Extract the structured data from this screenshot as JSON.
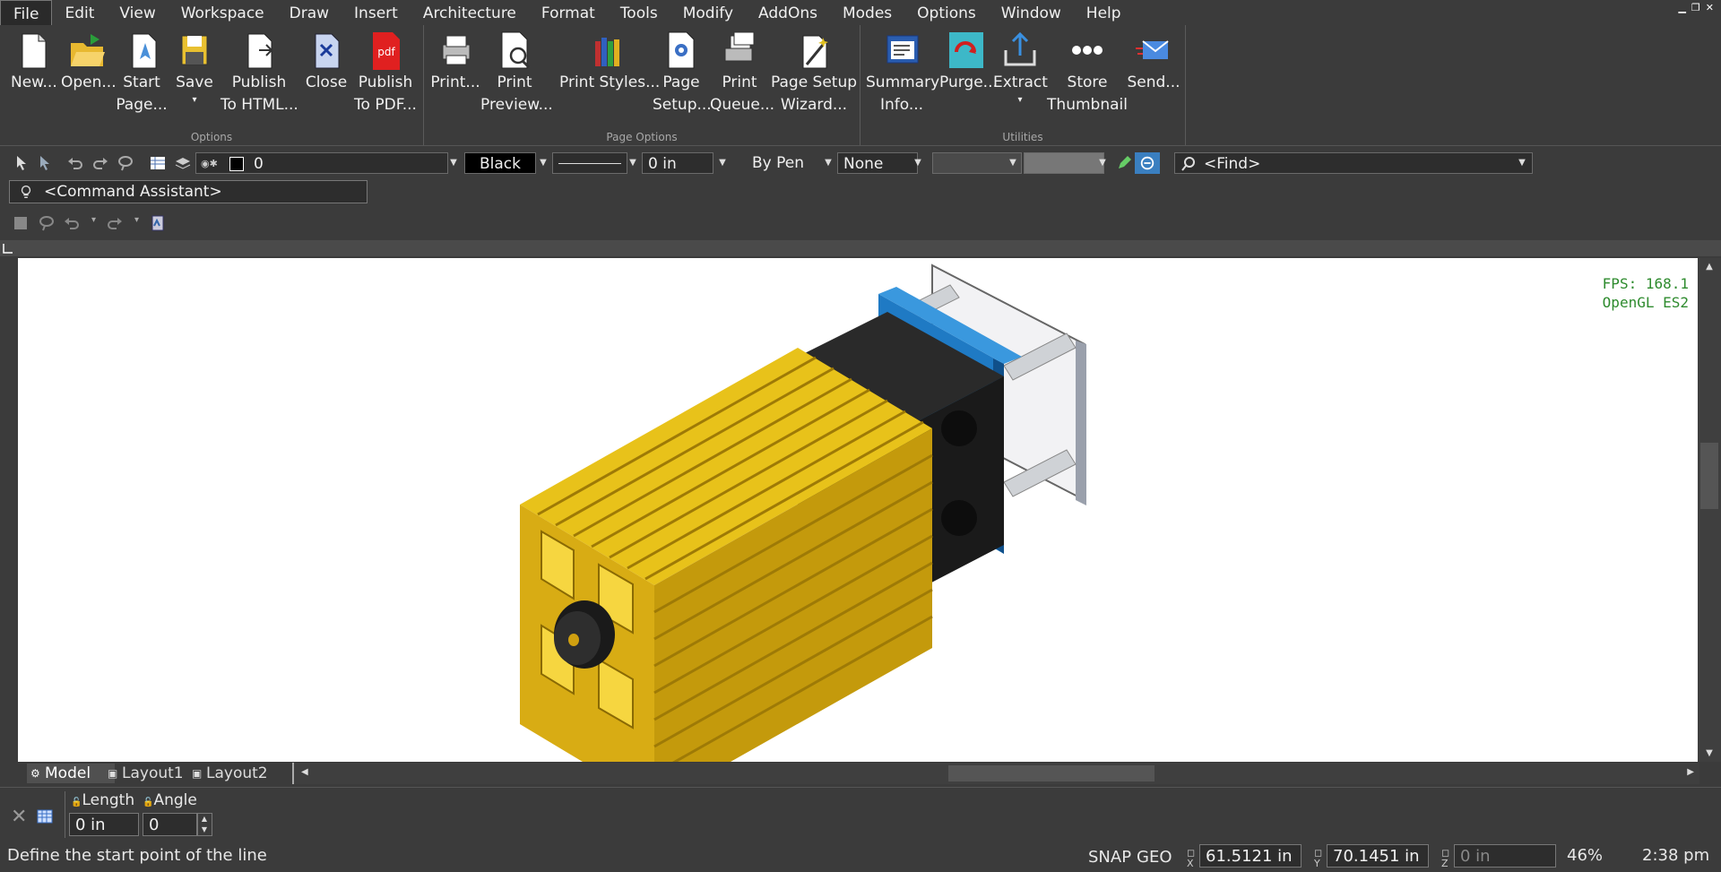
{
  "menu": [
    "File",
    "Edit",
    "View",
    "Workspace",
    "Draw",
    "Insert",
    "Architecture",
    "Format",
    "Tools",
    "Modify",
    "AddOns",
    "Modes",
    "Options",
    "Window",
    "Help"
  ],
  "ribbon": {
    "groups": {
      "options": "Options",
      "page_options": "Page Options",
      "utilities": "Utilities"
    },
    "buttons": [
      {
        "line1": "New...",
        "line2": ""
      },
      {
        "line1": "Open...",
        "line2": ""
      },
      {
        "line1": "Start",
        "line2": "Page..."
      },
      {
        "line1": "Save",
        "line2": "▾"
      },
      {
        "line1": "Publish",
        "line2": "To HTML..."
      },
      {
        "line1": "Close",
        "line2": ""
      },
      {
        "line1": "Publish",
        "line2": "To PDF..."
      },
      {
        "line1": "Print...",
        "line2": ""
      },
      {
        "line1": "Print",
        "line2": "Preview..."
      },
      {
        "line1": "Print Styles...",
        "line2": ""
      },
      {
        "line1": "Page",
        "line2": "Setup..."
      },
      {
        "line1": "Print",
        "line2": "Queue..."
      },
      {
        "line1": "Page Setup",
        "line2": "Wizard..."
      },
      {
        "line1": "Summary",
        "line2": "Info..."
      },
      {
        "line1": "Purge...",
        "line2": ""
      },
      {
        "line1": "Extract",
        "line2": "▾"
      },
      {
        "line1": "Store",
        "line2": "Thumbnail"
      },
      {
        "line1": "Send...",
        "line2": ""
      }
    ],
    "pdf_icon_text": "pdf"
  },
  "toolbar": {
    "layer_value": "0",
    "color_value": "Black",
    "lineweight_value": "0 in",
    "pen_value": "By Pen",
    "hatch_value": "None",
    "find_placeholder": "<Find>",
    "command_assistant": "<Command Assistant>"
  },
  "viewport": {
    "fps": "FPS: 168.1",
    "renderer": "OpenGL ES2"
  },
  "tabs": [
    "Model",
    "Layout1",
    "Layout2"
  ],
  "command": {
    "length_label": "Length",
    "length_value": "0 in",
    "angle_label": "Angle",
    "angle_value": "0"
  },
  "status": {
    "prompt": "Define the start point of the line",
    "snap": "SNAP",
    "geo": "GEO",
    "x_label": "X",
    "x_value": "61.5121 in",
    "y_label": "Y",
    "y_value": "70.1451 in",
    "z_label": "Z",
    "z_value": "0 in",
    "zoom": "46%",
    "time": "2:38 pm"
  }
}
